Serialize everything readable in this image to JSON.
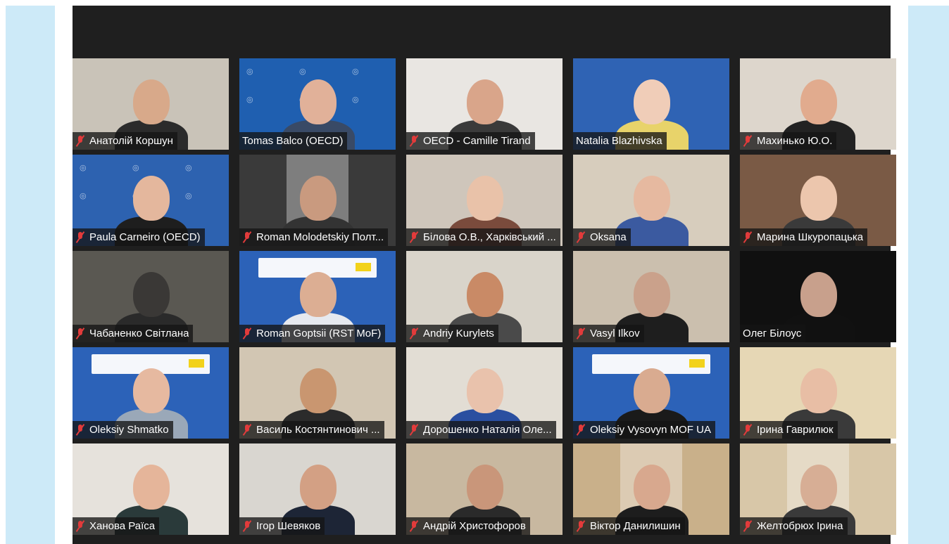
{
  "meeting": {
    "participants": [
      {
        "name": "Анатолій Коршун",
        "muted": true,
        "bg": "#c9c3b8",
        "skin": "#d8a98a",
        "shirt": "#2b2b2b",
        "type": "person"
      },
      {
        "name": "Tomas Balco (OECD)",
        "muted": false,
        "bg": "#1f5fb0",
        "skin": "#e1b199",
        "shirt": "#394a66",
        "type": "oecd",
        "active": true
      },
      {
        "name": "OECD - Camille Tirand",
        "muted": true,
        "bg": "#e9e6e2",
        "skin": "#d9a58a",
        "shirt": "#3a3a3a",
        "type": "person"
      },
      {
        "name": "Natalia Blazhivska",
        "muted": false,
        "bg": "#2f63b4",
        "skin": "#f0cdb8",
        "shirt": "#e8d36a",
        "type": "court"
      },
      {
        "name": "Махинько Ю.О.",
        "muted": true,
        "bg": "#ddd6cc",
        "skin": "#e1ab8e",
        "shirt": "#222222",
        "type": "person"
      },
      {
        "name": "Paula Carneiro (OECD)",
        "muted": true,
        "bg": "#2d62b0",
        "skin": "#e4b79d",
        "shirt": "#1e1e1e",
        "type": "oecd"
      },
      {
        "name": "Roman Molodetskiy Полт...",
        "muted": true,
        "bg": "#3a3a3a",
        "skin": "#c99a7f",
        "shirt": "#333333",
        "type": "door"
      },
      {
        "name": "Білова О.В., Харківський ...",
        "muted": true,
        "bg": "#cfc6bb",
        "skin": "#e9c2a9",
        "shirt": "#7a4b3c",
        "type": "person"
      },
      {
        "name": "Oksana",
        "muted": true,
        "bg": "#d7cdbd",
        "skin": "#e6b9a0",
        "shirt": "#3b5aa0",
        "type": "person"
      },
      {
        "name": "Марина Шкуропацька",
        "muted": true,
        "bg": "#7a5a45",
        "skin": "#ecc6ad",
        "shirt": "#3a3a3a",
        "type": "person"
      },
      {
        "name": "Чабаненко Світлана",
        "muted": true,
        "bg": "#5a5852",
        "skin": "#3a3836",
        "shirt": "#2a2a2a",
        "type": "dim"
      },
      {
        "name": "Roman Goptsii (RST MoF)",
        "muted": true,
        "bg": "#2c62b8",
        "skin": "#dcae93",
        "shirt": "#e6e9ef",
        "type": "banner"
      },
      {
        "name": "Andriy Kurylets",
        "muted": true,
        "bg": "#d9d4ca",
        "skin": "#c98a66",
        "shirt": "#4a4a4a",
        "type": "person"
      },
      {
        "name": "Vasyl Ilkov",
        "muted": true,
        "bg": "#cbbfae",
        "skin": "#caa18b",
        "shirt": "#1e1e1e",
        "type": "person"
      },
      {
        "name": "Олег Білоус",
        "muted": false,
        "bg": "#101010",
        "skin": "#c8a08c",
        "shirt": "#111111",
        "type": "person"
      },
      {
        "name": "Oleksiy Shmatko",
        "muted": true,
        "bg": "#2c62b8",
        "skin": "#e6b9a0",
        "shirt": "#9aa8b8",
        "type": "banner"
      },
      {
        "name": "Василь Костянтинович ...",
        "muted": true,
        "bg": "#d2c6b3",
        "skin": "#c99670",
        "shirt": "#2b2b2b",
        "type": "person"
      },
      {
        "name": "Дорошенко Наталія Оле...",
        "muted": true,
        "bg": "#e2ddd4",
        "skin": "#e9c2ac",
        "shirt": "#2a4fa0",
        "type": "person"
      },
      {
        "name": "Oleksiy Vysovyn MOF UA",
        "muted": true,
        "bg": "#2c62b8",
        "skin": "#d9ab90",
        "shirt": "#1a1a1a",
        "type": "banner"
      },
      {
        "name": "Ірина Гаврилюк",
        "muted": true,
        "bg": "#e6d7b5",
        "skin": "#e8bea5",
        "shirt": "#3a3a3a",
        "type": "person"
      },
      {
        "name": "Ханова Раїса",
        "muted": true,
        "bg": "#e6e2dc",
        "skin": "#e5b59a",
        "shirt": "#2a3a3a",
        "type": "person"
      },
      {
        "name": "Ігор Шевяков",
        "muted": true,
        "bg": "#d9d6d0",
        "skin": "#d3a084",
        "shirt": "#1d2536",
        "type": "person"
      },
      {
        "name": "Андрій Христофоров",
        "muted": true,
        "bg": "#c8b8a0",
        "skin": "#c9967a",
        "shirt": "#2a2a2a",
        "type": "person"
      },
      {
        "name": "Віктор Данилишин",
        "muted": true,
        "bg": "#c9b08a",
        "skin": "#d8a88e",
        "shirt": "#1d1d1d",
        "type": "door"
      },
      {
        "name": "Желтобрюх Ірина",
        "muted": true,
        "bg": "#d8c7a8",
        "skin": "#d7ae95",
        "shirt": "#3a3a3a",
        "type": "door"
      }
    ]
  }
}
